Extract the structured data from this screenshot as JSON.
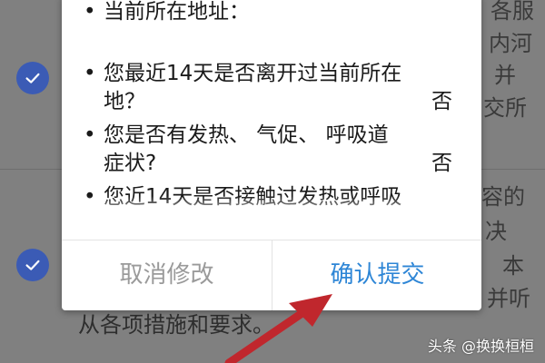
{
  "background": {
    "right_fragments": [
      "各服",
      "内河",
      "并",
      "交所",
      "容的",
      "决",
      "本",
      "并听"
    ],
    "bottom_line": "从各项措施和要求。"
  },
  "dialog": {
    "questions": [
      {
        "lines": [
          "当前所在地址："
        ],
        "answer": ""
      },
      {
        "lines": [
          "您最近14天是否离开过当前所在",
          "地？"
        ],
        "answer": "否"
      },
      {
        "lines": [
          "您是否有发热、 气促、 呼吸道",
          "症状?"
        ],
        "answer": "否"
      },
      {
        "lines": [
          "您近14天是否接触过发热或呼吸"
        ],
        "answer": ""
      }
    ],
    "cancel_label": "取消修改",
    "confirm_label": "确认提交"
  },
  "watermark": "头条 @换换桓桓",
  "colors": {
    "check_blue": "#3b5bb5",
    "confirm_blue": "#2e86d6",
    "arrow_red": "#c0272d"
  }
}
